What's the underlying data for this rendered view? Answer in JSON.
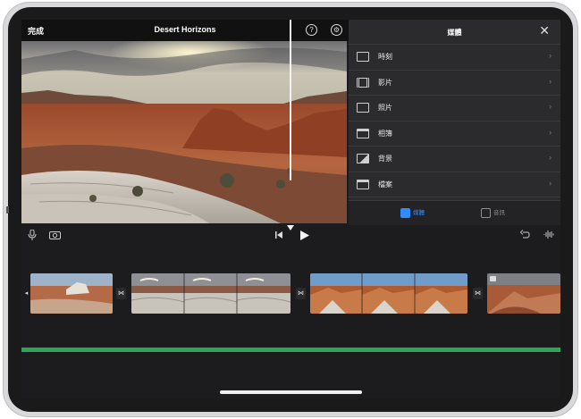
{
  "toolbar": {
    "done_label": "完成",
    "project_title": "Desert Horizons",
    "help_icon": "question-circle-icon",
    "settings_icon": "gear-circle-icon"
  },
  "media_panel": {
    "title": "媒體",
    "items": [
      {
        "label": "時刻",
        "icon": "moments-icon"
      },
      {
        "label": "影片",
        "icon": "film-icon"
      },
      {
        "label": "照片",
        "icon": "photo-icon"
      },
      {
        "label": "相簿",
        "icon": "album-icon"
      },
      {
        "label": "背景",
        "icon": "background-icon"
      },
      {
        "label": "檔案",
        "icon": "folder-icon"
      }
    ],
    "tabs": [
      {
        "label": "媒體",
        "active": true,
        "color": "#2f8cff"
      },
      {
        "label": "音訊",
        "active": false,
        "color": "#8e8e93"
      }
    ]
  },
  "colors": {
    "accent": "#2f8cff",
    "audio_track": "#2ea35a",
    "background": "#1c1c1e"
  }
}
